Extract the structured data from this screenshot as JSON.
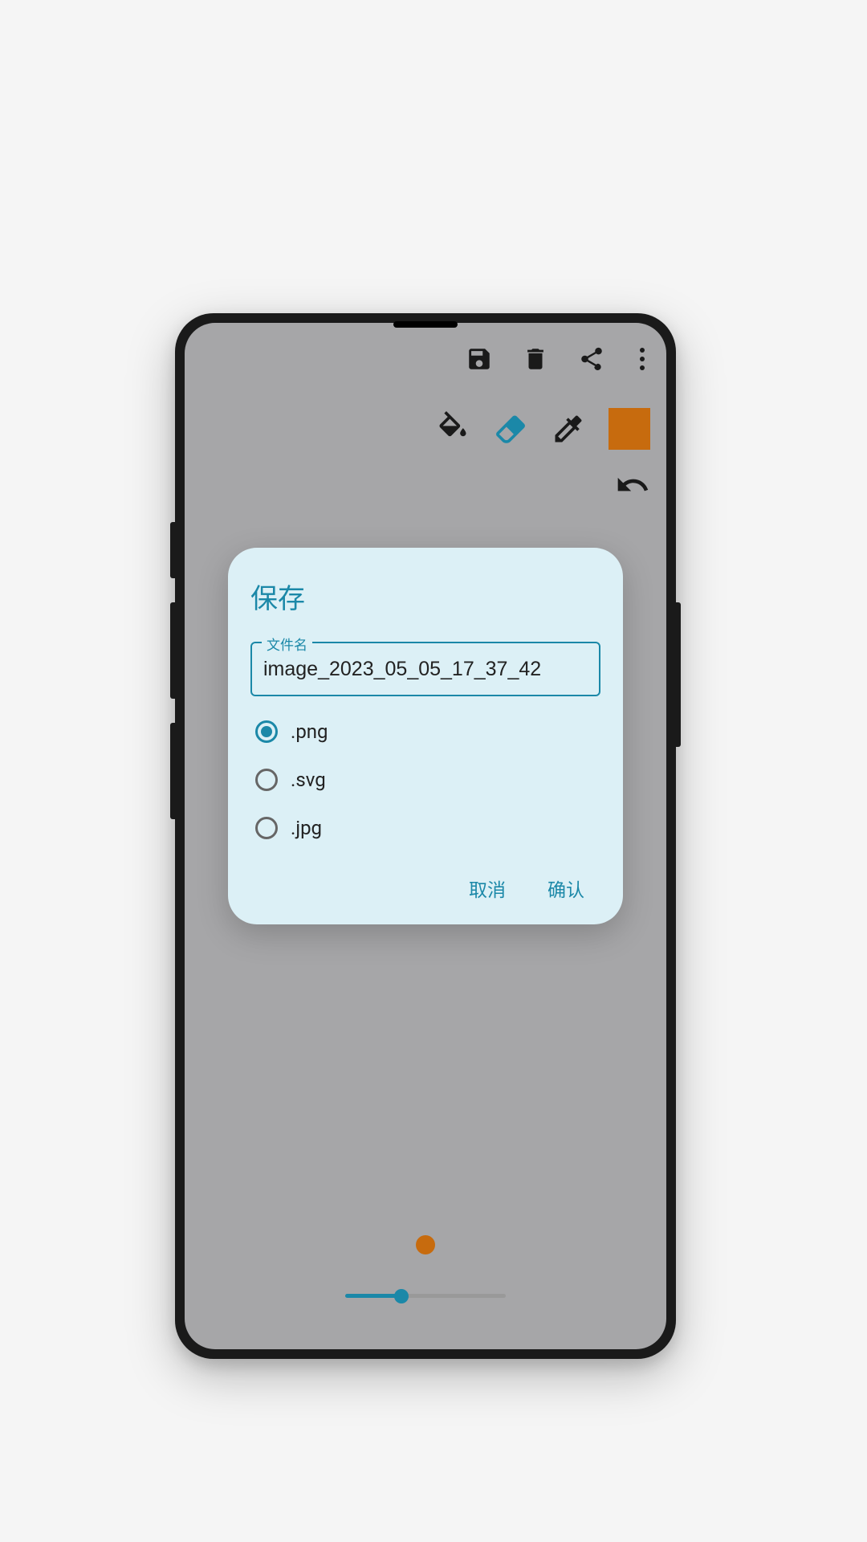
{
  "toolbar": {
    "save_icon": "save-icon",
    "delete_icon": "trash-icon",
    "share_icon": "share-icon",
    "overflow_icon": "overflow-menu-icon"
  },
  "tools": {
    "fill_icon": "paint-bucket-icon",
    "eraser_icon": "eraser-icon",
    "eyedropper_icon": "eyedropper-icon",
    "active_color": "#c76b0e",
    "undo_icon": "undo-icon"
  },
  "dialog": {
    "title": "保存",
    "filename_label": "文件名",
    "filename_value": "image_2023_05_05_17_37_42",
    "formats": [
      {
        "label": ".png",
        "selected": true
      },
      {
        "label": ".svg",
        "selected": false
      },
      {
        "label": ".jpg",
        "selected": false
      }
    ],
    "cancel_label": "取消",
    "confirm_label": "确认"
  },
  "brush_slider_percent": 35
}
